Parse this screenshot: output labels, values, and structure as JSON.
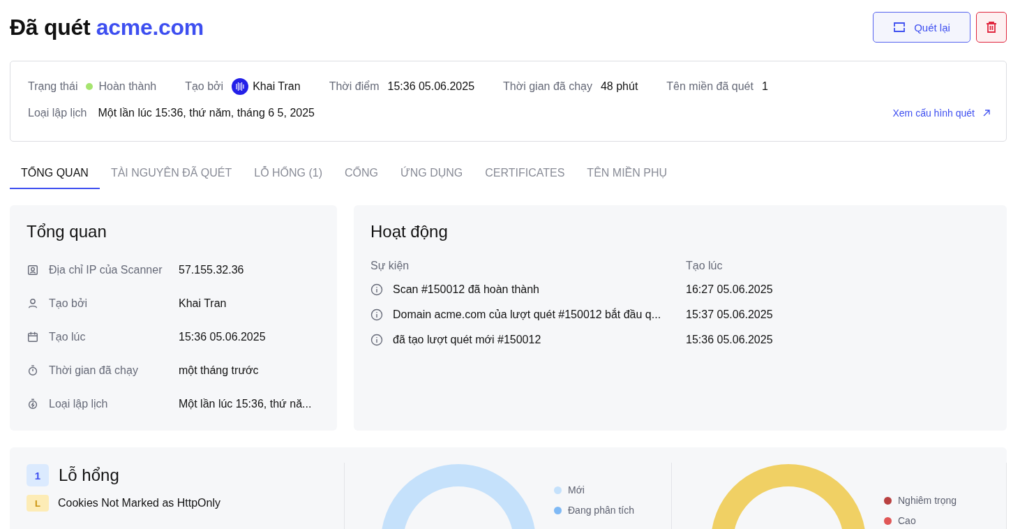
{
  "header": {
    "title_prefix": "Đã quét",
    "title_domain": "acme.com",
    "rescan_button": "Quét lại"
  },
  "info": {
    "fields": [
      {
        "kind": "status",
        "label": "Trạng thái",
        "value": "Hoàn thành"
      },
      {
        "kind": "user",
        "label": "Tạo bởi",
        "value": "Khai Tran"
      },
      {
        "kind": "text",
        "label": "Thời điểm",
        "value": "15:36 05.06.2025"
      },
      {
        "kind": "text",
        "label": "Thời gian đã chạy",
        "value": "48 phút"
      },
      {
        "kind": "text",
        "label": "Tên miền đã quét",
        "value": "1"
      }
    ],
    "schedule_label": "Loại lập lịch",
    "schedule_value": "Một lần lúc 15:36, thứ năm, tháng 6 5, 2025",
    "config_link": "Xem cấu hình quét"
  },
  "tabs": [
    {
      "label": "TỔNG QUAN",
      "selected": true
    },
    {
      "label": "TÀI NGUYÊN ĐÃ QUÉT",
      "selected": false
    },
    {
      "label": "LỖ HỔNG (1)",
      "selected": false
    },
    {
      "label": "CỔNG",
      "selected": false
    },
    {
      "label": "ỨNG DỤNG",
      "selected": false
    },
    {
      "label": "CERTIFICATES",
      "selected": false
    },
    {
      "label": "TÊN MIỀN PHỤ",
      "selected": false
    }
  ],
  "overview": {
    "title": "Tổng quan",
    "rows": [
      {
        "kind": "ip",
        "label": "Địa chỉ IP của Scanner",
        "value": "57.155.32.36"
      },
      {
        "kind": "user",
        "label": "Tạo bởi",
        "value": "Khai Tran"
      },
      {
        "kind": "calendar",
        "label": "Tạo lúc",
        "value": "15:36 05.06.2025"
      },
      {
        "kind": "timer",
        "label": "Thời gian đã chạy",
        "value": "một tháng trước"
      },
      {
        "kind": "schedule",
        "label": "Loại lập lịch",
        "value": "Một lần lúc 15:36, thứ nă..."
      }
    ]
  },
  "activity": {
    "title": "Hoạt động",
    "columns": [
      "Sự kiện",
      "Tạo lúc"
    ],
    "rows": [
      {
        "event": "Scan #150012 đã hoàn thành",
        "time": "16:27 05.06.2025"
      },
      {
        "event": "Domain acme.com của lượt quét #150012 bắt đầu q...",
        "time": "15:37 05.06.2025"
      },
      {
        "event": "đã tạo lượt quét mới #150012",
        "time": "15:36 05.06.2025"
      }
    ]
  },
  "vulnerabilities": {
    "count": "1",
    "title": "Lỗ hổng",
    "items": [
      {
        "severity": "L",
        "name": "Cookies Not Marked as HttpOnly"
      }
    ],
    "status_legend": [
      {
        "label": "Mới",
        "color": "#c5e1fb"
      },
      {
        "label": "Đang phân tích",
        "color": "#7fb9f5"
      }
    ],
    "severity_legend": [
      {
        "label": "Nghiêm trọng",
        "color": "#b94141"
      },
      {
        "label": "Cao",
        "color": "#e05757"
      }
    ]
  }
}
